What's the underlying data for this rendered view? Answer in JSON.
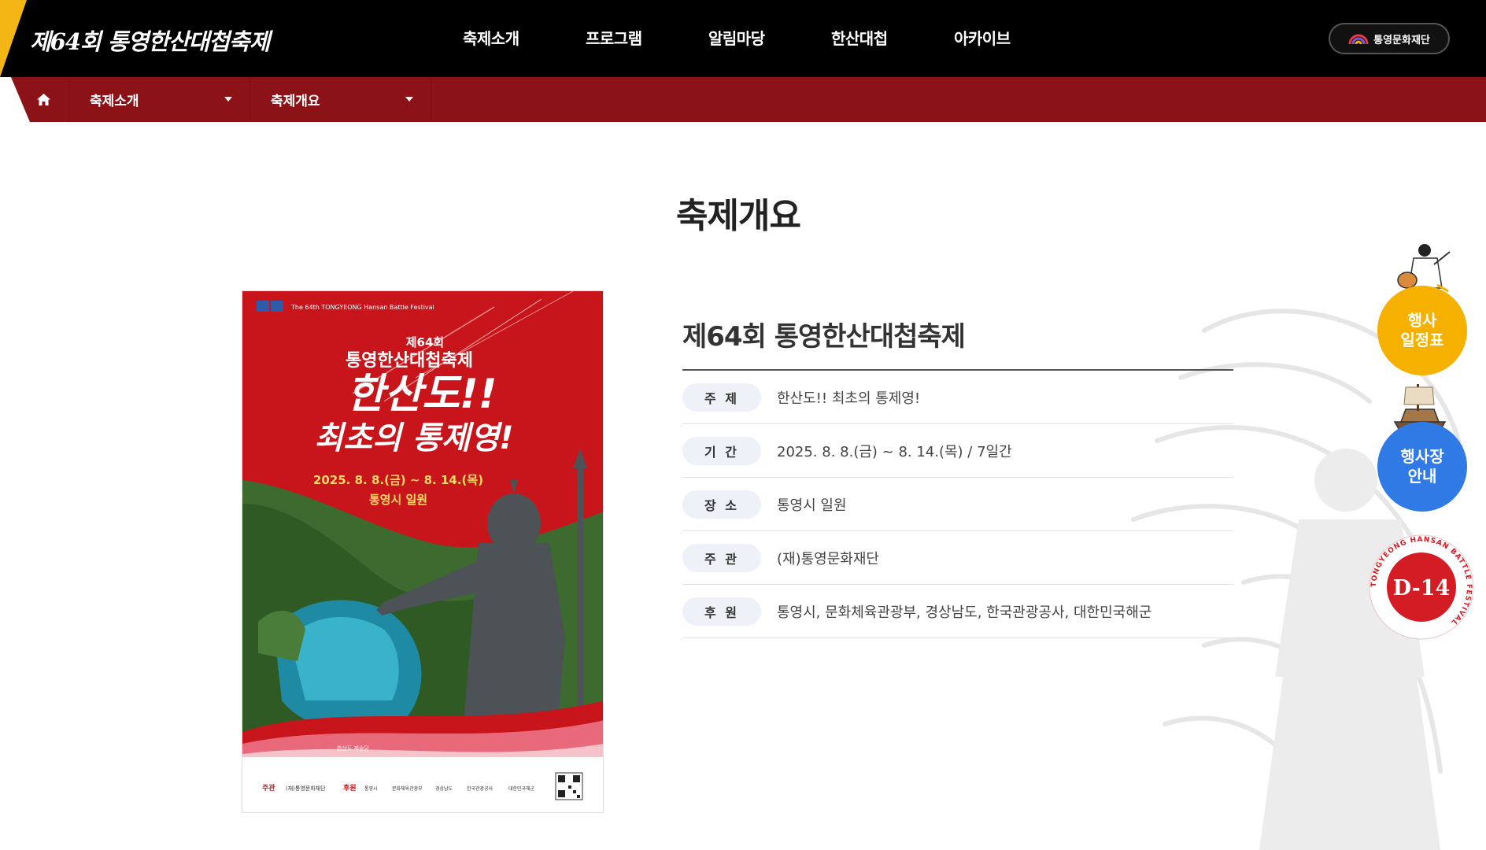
{
  "header": {
    "logo_text": "제64회 통영한산대첩축제",
    "nav": [
      "축제소개",
      "프로그램",
      "알림마당",
      "한산대첩",
      "아카이브"
    ],
    "foundation_label": "통영문화재단"
  },
  "subnav": {
    "depth1": "축제소개",
    "depth2": "축제개요"
  },
  "page": {
    "title": "축제개요"
  },
  "poster": {
    "header_text": "The 64th TONGYEONG Hansan Battle Festival",
    "edition": "제64회",
    "festival_name": "통영한산대첩축제",
    "slogan_1": "한산도!!",
    "slogan_2": "최초의 통제영!",
    "dates": "2025. 8. 8.(금) ~ 8. 14.(목)",
    "venue": "통영시 일원",
    "caption": "한산도 제승당",
    "host_label": "주관",
    "host_name": "(재)통영문화재단",
    "sponsor_label": "후원",
    "sponsors": [
      "통영시",
      "문화체육관광부",
      "경상남도",
      "한국관광공사",
      "대한민국해군"
    ]
  },
  "info": {
    "title": "제64회 통영한산대첩축제",
    "rows": [
      {
        "label": "주 제",
        "value": "한산도!! 최초의 통제영!"
      },
      {
        "label": "기 간",
        "value": "2025. 8. 8.(금) ~ 8. 14.(목) / 7일간"
      },
      {
        "label": "장 소",
        "value": "통영시 일원"
      },
      {
        "label": "주 관",
        "value": "(재)통영문화재단"
      },
      {
        "label": "후 원",
        "value": "통영시, 문화체육관광부, 경상남도, 한국관광공사, 대한민국해군"
      }
    ]
  },
  "quick_menu": {
    "schedule": "행사\n일정표",
    "schedule_line1": "행사",
    "schedule_line2": "일정표",
    "venue_line1": "행사장",
    "venue_line2": "안내",
    "dday": "D-14",
    "dday_ring_text": "TONGYEONG HANSAN BATTLE FESTIVAL"
  },
  "colors": {
    "header_bg": "#000000",
    "subnav_bg": "#8b1318",
    "accent_yellow": "#f5b000",
    "accent_blue": "#2f7ae5",
    "poster_red": "#c8151c"
  }
}
